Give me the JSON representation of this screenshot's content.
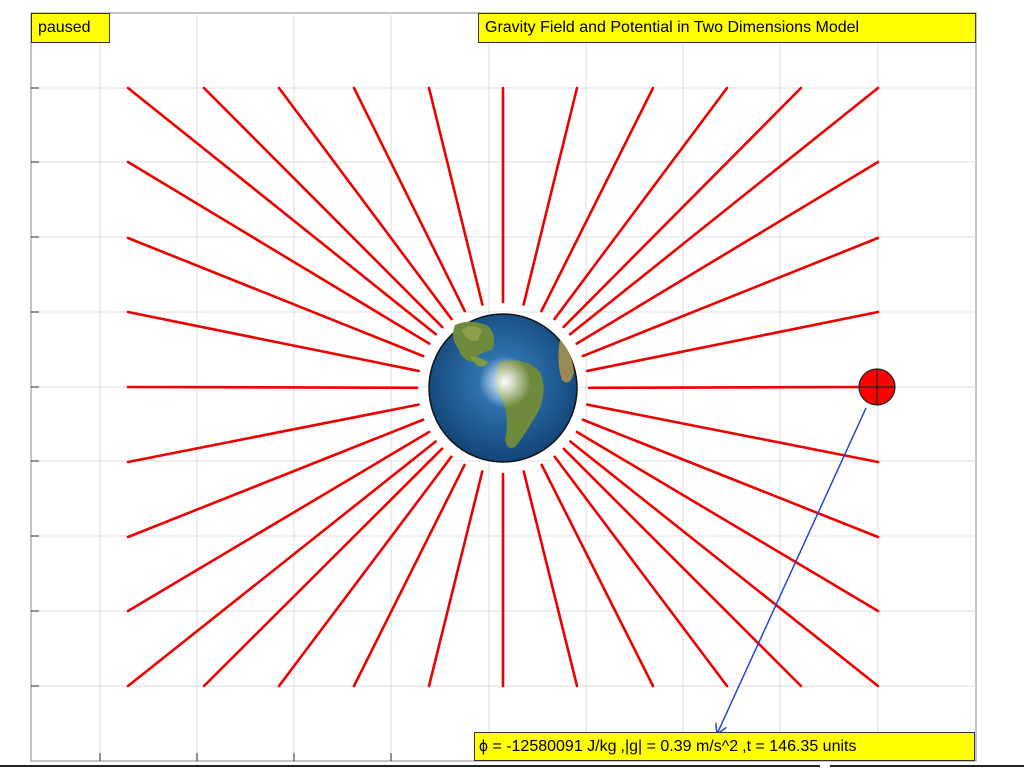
{
  "status": {
    "label": "paused"
  },
  "title": {
    "text": "Gravity Field and Potential in Two Dimensions Model"
  },
  "readout": {
    "phi": "ϕ = -12580091 J/kg",
    "g": ",|g| = 0.39 m/s^2",
    "t": ",t = 146.35 units"
  },
  "scene": {
    "planet": {
      "name": "earth",
      "ocean_color": "#1e5f9c",
      "land_color": "#6e8a3c"
    },
    "field_line_color": "#ee0000",
    "test_mass_color": "#ff0000",
    "vector_color": "#2244dd",
    "grid_color": "#dcdcdc"
  },
  "icons": {
    "test_mass": "crosshair-circle-icon",
    "vector_head": "arrowhead-icon"
  }
}
